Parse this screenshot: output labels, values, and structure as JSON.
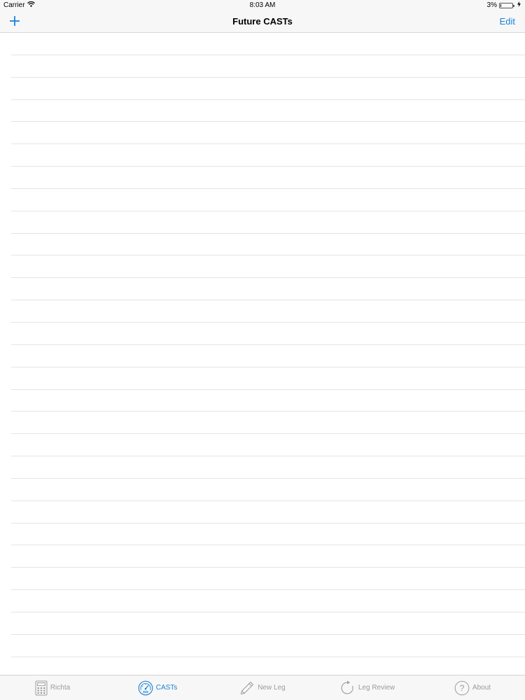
{
  "status_bar": {
    "carrier": "Carrier",
    "time": "8:03 AM",
    "battery_percent": "3%",
    "battery_level": 0.03
  },
  "nav_bar": {
    "title": "Future CASTs",
    "edit_label": "Edit",
    "add_icon": "plus-icon"
  },
  "list": {
    "row_count": 28
  },
  "tab_bar": {
    "tabs": [
      {
        "label": "Richta",
        "icon": "calculator-icon",
        "active": false
      },
      {
        "label": "CASTs",
        "icon": "gauge-icon",
        "active": true
      },
      {
        "label": "New Leg",
        "icon": "pencil-icon",
        "active": false
      },
      {
        "label": "Leg Review",
        "icon": "refresh-icon",
        "active": false
      },
      {
        "label": "About",
        "icon": "question-circle-icon",
        "active": false
      }
    ]
  },
  "colors": {
    "accent": "#1a82d8",
    "inactive": "#9b9b9b",
    "bar_background": "#f7f7f7",
    "separator": "#e4e4e4"
  }
}
